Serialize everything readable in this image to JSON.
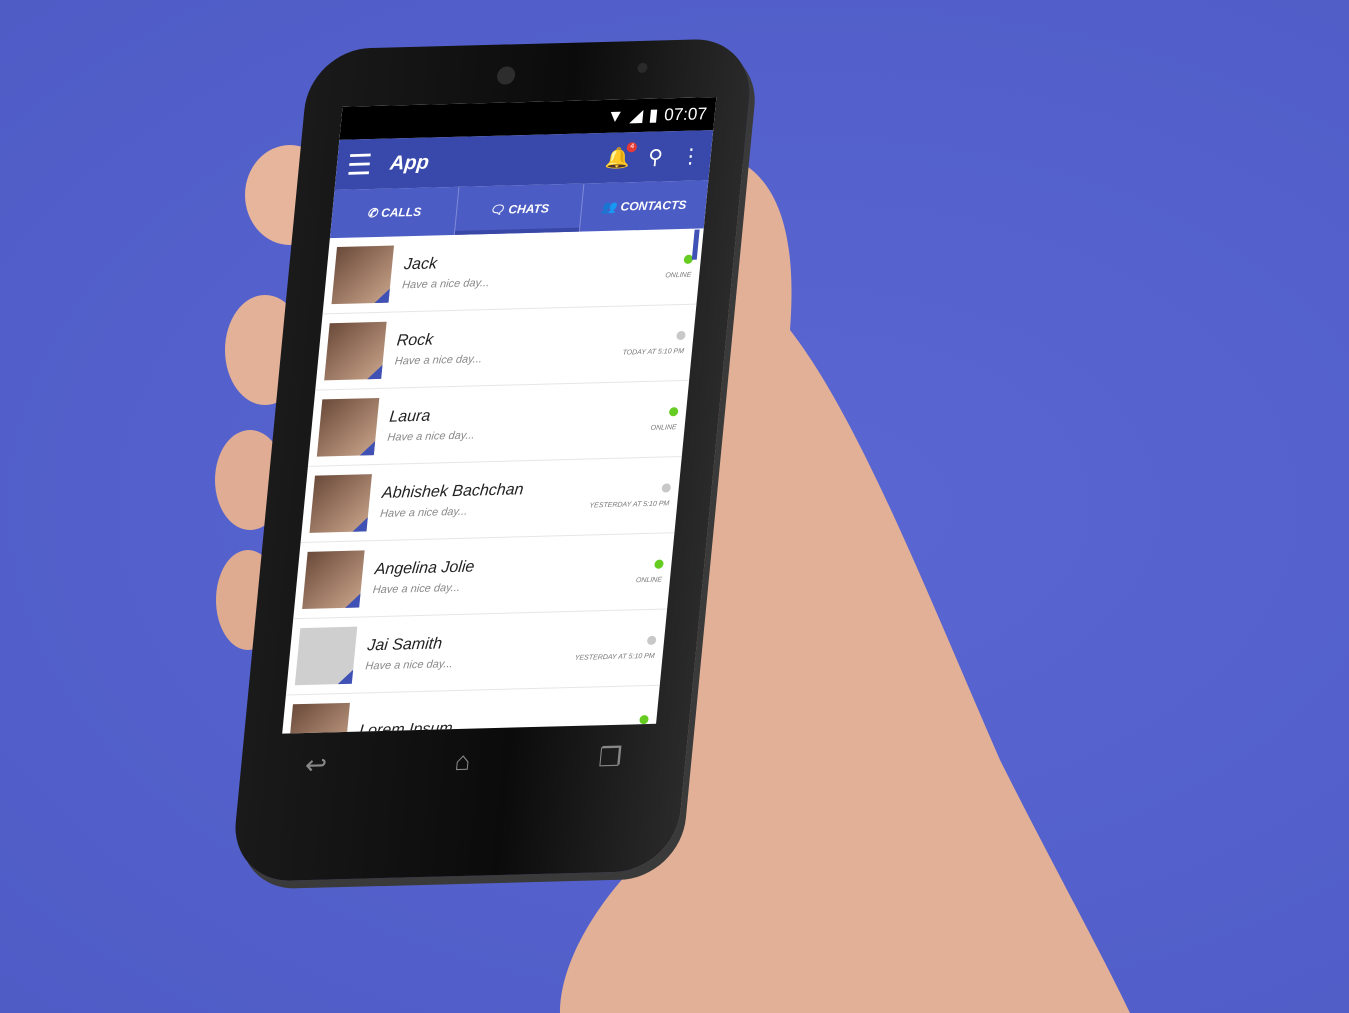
{
  "status_bar": {
    "time": "07:07",
    "icons": [
      "wifi-icon",
      "signal-icon",
      "battery-icon"
    ]
  },
  "app_bar": {
    "title": "App",
    "notification_count": "4",
    "icons": [
      "menu-icon",
      "bell-icon",
      "search-icon",
      "more-vert-icon"
    ]
  },
  "tabs": [
    {
      "label": "CALLS",
      "icon": "phone-icon"
    },
    {
      "label": "CHATS",
      "icon": "chat-icon",
      "active": true
    },
    {
      "label": "CONTACTS",
      "icon": "contacts-icon"
    }
  ],
  "chats": [
    {
      "name": "Jack",
      "message": "Have a nice day...",
      "status": "ONLINE",
      "online": true
    },
    {
      "name": "Rock",
      "message": "Have a nice day...",
      "status": "TODAY AT 5:10 PM",
      "online": false
    },
    {
      "name": "Laura",
      "message": "Have a nice day...",
      "status": "ONLINE",
      "online": true
    },
    {
      "name": "Abhishek Bachchan",
      "message": "Have a nice day...",
      "status": "YESTERDAY AT 5:10 PM",
      "online": false
    },
    {
      "name": "Angelina Jolie",
      "message": "Have a nice day...",
      "status": "ONLINE",
      "online": true
    },
    {
      "name": "Jai Samith",
      "message": "Have a nice day...",
      "status": "YESTERDAY AT 5:10 PM",
      "online": false
    },
    {
      "name": "Lorem Ipsum",
      "online": true
    }
  ],
  "colors": {
    "primary": "#3949ab",
    "tabs": "#4b5cc4",
    "online": "#66cc22",
    "offline": "#c8c8c8",
    "background": "#5461cc"
  }
}
